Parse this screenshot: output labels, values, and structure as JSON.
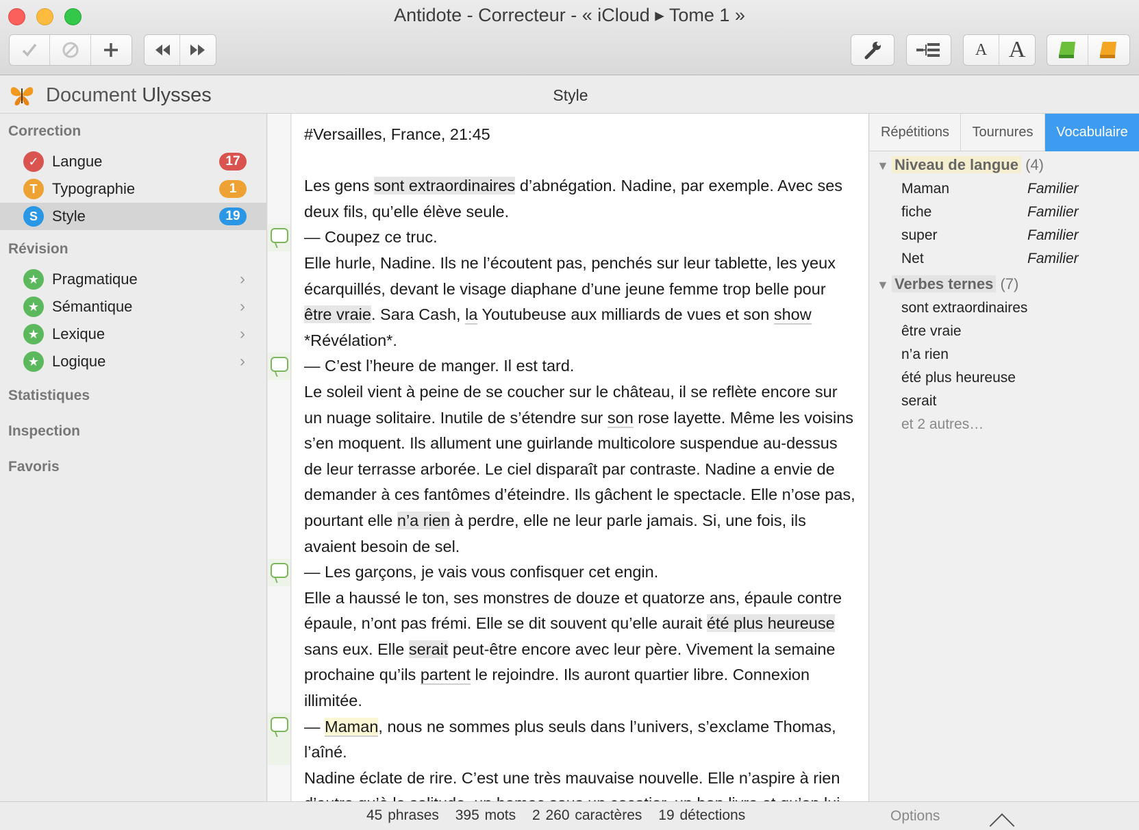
{
  "window": {
    "title": "Antidote - Correcteur - « iCloud ▸ Tome 1 »"
  },
  "toolbar": {
    "check_icon": "checkmark-icon",
    "ignore_icon": "ignore-icon",
    "add_icon": "plus-icon",
    "prev_icon": "rewind-icon",
    "next_icon": "fast-forward-icon",
    "settings_icon": "wrench-icon",
    "tree_icon": "tree-icon",
    "font_small": "A",
    "font_large": "A",
    "dict_green_icon": "green-book-icon",
    "dict_orange_icon": "orange-book-icon"
  },
  "header": {
    "doc_label": "Document",
    "doc_app": "Ulysses",
    "center": "Style"
  },
  "sidebar": {
    "correction_title": "Correction",
    "correction_items": [
      {
        "icon": "✓",
        "label": "Langue",
        "count": "17",
        "color": "#d9534f"
      },
      {
        "icon": "T",
        "label": "Typographie",
        "count": "1",
        "color": "#efa234"
      },
      {
        "icon": "S",
        "label": "Style",
        "count": "19",
        "color": "#2a96e6"
      }
    ],
    "revision_title": "Révision",
    "revision_items": [
      {
        "label": "Pragmatique"
      },
      {
        "label": "Sémantique"
      },
      {
        "label": "Lexique"
      },
      {
        "label": "Logique"
      }
    ],
    "stats_title": "Statistiques",
    "inspection_title": "Inspection",
    "favoris_title": "Favoris"
  },
  "text": {
    "heading": "#Versailles, France, 21:45",
    "p1a": "Les gens ",
    "p1hl": "sont extraordinaires",
    "p1b": " d’abnégation. Nadine, par exemple. Avec ses deux fils, qu’elle élève seule.",
    "d1": "— Coupez ce truc.",
    "p2a": "Elle hurle, Nadine. Ils ne l’écoutent pas, penchés sur leur tablette, les yeux écarquillés, devant le visage diaphane d’une jeune femme trop belle pour ",
    "p2hl": "être vraie",
    "p2b": ". Sara Cash, ",
    "p2la": "la",
    "p2c": " Youtubeuse aux milliards de vues et son ",
    "p2show": "show",
    "p2d": " *Révélation*.",
    "d2": "— C’est l’heure de manger. Il est tard.",
    "p3a": "Le soleil vient à peine de se coucher sur le château, il se reflète encore sur un nuage solitaire. Inutile de s’étendre sur ",
    "p3son": "son",
    "p3b": " rose layette. Même les voisins s’en moquent. Ils allument une guirlande multicolore suspendue au-dessus de leur terrasse arborée. Le ciel disparaît par contraste. Nadine a envie de demander à ces fantômes d’éteindre. Ils gâchent le spectacle. Elle n’ose pas, pourtant elle ",
    "p3hl": "n’a rien",
    "p3c": " à perdre, elle ne leur parle jamais. Si, une fois, ils avaient besoin de sel.",
    "d3": "— Les garçons, je vais vous confisquer cet engin.",
    "p4a": "Elle a haussé le ton, ses monstres de douze et quatorze ans, épaule contre épaule, n’ont pas frémi. Elle se dit souvent qu’elle aurait ",
    "p4hl": "été plus heureuse",
    "p4b": " sans eux. Elle ",
    "p4hl2": "serait",
    "p4c": " peut-être encore avec leur père. Vivement la semaine prochaine qu’ils ",
    "p4part": "partent",
    "p4d": " le rejoindre. Ils auront quartier libre. Connexion illimitée.",
    "d4a": "— ",
    "d4hl": "Maman",
    "d4b": ", nous ne sommes plus seuls dans l’univers, s’exclame Thomas, l’aîné.",
    "p5": "Nadine éclate de rire. C’est une très mauvaise nouvelle. Elle n’aspire à rien d’autre qu’à la solitude, un hamac sous un cocotier, un bon livre et qu’on lui"
  },
  "rpanel": {
    "tabs": [
      "Répétitions",
      "Tournures",
      "Vocabulaire"
    ],
    "group1": {
      "title": "Niveau de langue",
      "count": "(4)"
    },
    "group1_items": [
      {
        "word": "Maman",
        "tag": "Familier"
      },
      {
        "word": "fiche",
        "tag": "Familier"
      },
      {
        "word": "super",
        "tag": "Familier"
      },
      {
        "word": "Net",
        "tag": "Familier"
      }
    ],
    "group2": {
      "title": "Verbes ternes",
      "count": "(7)"
    },
    "group2_items": [
      "sont extraordinaires",
      "être vraie",
      "n’a rien",
      "été plus heureuse",
      "serait"
    ],
    "more": "et 2 autres…"
  },
  "status": {
    "phrases": "45 phrases",
    "mots": "395 mots",
    "caracteres": "2 260 caractères",
    "detections": "19 détections",
    "options": "Options"
  }
}
